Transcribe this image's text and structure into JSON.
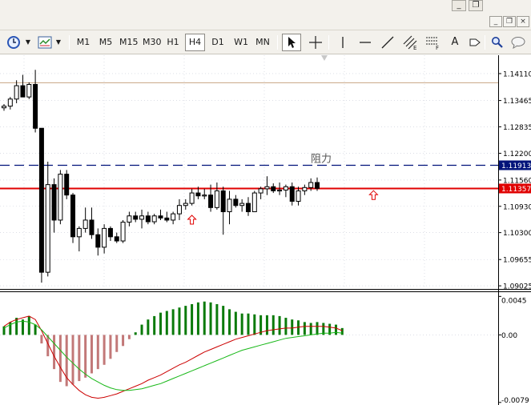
{
  "indicator_colors": {
    "background": "#ffffff",
    "grid": "#c8cbd8",
    "axis": "#000000",
    "resistance_line": "#00137a",
    "price_line": "#e00000",
    "high_line": "#c8a582",
    "histogram_up": "#0a7a0a",
    "histogram_down": "#c27878",
    "macd_line": "#cc0000",
    "signal_line": "#18b818",
    "candle": "#000000"
  },
  "menubar": {
    "mdi_buttons": [
      {
        "icon": "minimize-icon",
        "glyph": "_"
      },
      {
        "icon": "restore-icon",
        "glyph": "❐"
      },
      {
        "icon": "close-icon",
        "glyph": "×"
      }
    ]
  },
  "window_buttons": [
    {
      "icon": "minimize-icon",
      "glyph": "_"
    },
    {
      "icon": "restore-icon",
      "glyph": "❐"
    }
  ],
  "toolbar": {
    "timeframes": [
      {
        "label": "M1",
        "active": false
      },
      {
        "label": "M5",
        "active": false
      },
      {
        "label": "M15",
        "active": false
      },
      {
        "label": "M30",
        "active": false
      },
      {
        "label": "H1",
        "active": false
      },
      {
        "label": "H4",
        "active": true
      },
      {
        "label": "D1",
        "active": false
      },
      {
        "label": "W1",
        "active": false
      },
      {
        "label": "MN",
        "active": false
      }
    ],
    "tools": [
      {
        "icon": "clock-icon"
      },
      {
        "icon": "chart-template-icon"
      },
      {
        "icon": "cursor-icon"
      },
      {
        "icon": "crosshair-icon"
      },
      {
        "icon": "vertical-line-icon"
      },
      {
        "icon": "horizontal-line-icon"
      },
      {
        "icon": "trendline-icon"
      },
      {
        "icon": "equidistant-channel-icon",
        "letter": "E"
      },
      {
        "icon": "fibonacci-icon",
        "letter": "F"
      },
      {
        "icon": "text-tool-icon",
        "letter": "A"
      },
      {
        "icon": "text-label-icon"
      },
      {
        "icon": "search-icon"
      },
      {
        "icon": "chat-icon"
      }
    ]
  },
  "chart_data": [
    {
      "type": "candlestick",
      "ylim": [
        1.0895,
        1.1455
      ],
      "y_ticks": [
        "1.14110",
        "1.13465",
        "1.12835",
        "1.12200",
        "1.11560",
        "1.10930",
        "1.10300",
        "1.09655",
        "1.09025"
      ],
      "y_tick_values": [
        1.1411,
        1.13465,
        1.12835,
        1.122,
        1.1156,
        1.1093,
        1.103,
        1.09655,
        1.09025
      ],
      "resistance": {
        "value": 1.11913,
        "label": "1.11913",
        "text": "阻力"
      },
      "current_price": {
        "value": 1.11357,
        "label": "1.11357"
      },
      "high_line": 1.1389,
      "arrow_markers": [
        {
          "candle": 30,
          "price": 1.106
        },
        {
          "candle": 59,
          "price": 1.1119
        }
      ],
      "candles": [
        [
          1.1329,
          1.1338,
          1.1322,
          1.1333
        ],
        [
          1.1333,
          1.1355,
          1.1325,
          1.135
        ],
        [
          1.135,
          1.1395,
          1.134,
          1.1382
        ],
        [
          1.1382,
          1.1408,
          1.136,
          1.1355
        ],
        [
          1.1355,
          1.139,
          1.135,
          1.1385
        ],
        [
          1.1385,
          1.142,
          1.127,
          1.128
        ],
        [
          1.128,
          1.1235,
          1.091,
          1.0935
        ],
        [
          1.0935,
          1.12,
          1.0925,
          1.1145
        ],
        [
          1.1145,
          1.116,
          1.103,
          1.106
        ],
        [
          1.106,
          1.118,
          1.105,
          1.117
        ],
        [
          1.117,
          1.118,
          1.111,
          1.112
        ],
        [
          1.112,
          1.1125,
          1.1005,
          1.102
        ],
        [
          1.102,
          1.1045,
          1.0985,
          1.104
        ],
        [
          1.104,
          1.109,
          1.103,
          1.106
        ],
        [
          1.106,
          1.109,
          1.1015,
          1.1025
        ],
        [
          1.1025,
          1.104,
          1.0975,
          1.0995
        ],
        [
          1.0995,
          1.105,
          1.098,
          1.104
        ],
        [
          1.104,
          1.1045,
          1.101,
          1.102
        ],
        [
          1.102,
          1.103,
          1.1005,
          1.101
        ],
        [
          1.101,
          1.106,
          1.1005,
          1.1055
        ],
        [
          1.1055,
          1.108,
          1.1045,
          1.107
        ],
        [
          1.107,
          1.108,
          1.1055,
          1.1062
        ],
        [
          1.1062,
          1.1085,
          1.104,
          1.107
        ],
        [
          1.107,
          1.108,
          1.105,
          1.1056
        ],
        [
          1.1056,
          1.1075,
          1.105,
          1.107
        ],
        [
          1.107,
          1.1085,
          1.106,
          1.1065
        ],
        [
          1.1065,
          1.108,
          1.1055,
          1.106
        ],
        [
          1.106,
          1.108,
          1.105,
          1.1075
        ],
        [
          1.1075,
          1.111,
          1.106,
          1.1095
        ],
        [
          1.1095,
          1.111,
          1.1085,
          1.11
        ],
        [
          1.11,
          1.1135,
          1.1095,
          1.1125
        ],
        [
          1.1125,
          1.114,
          1.111,
          1.1118
        ],
        [
          1.1118,
          1.1135,
          1.111,
          1.112
        ],
        [
          1.112,
          1.1145,
          1.108,
          1.109
        ],
        [
          1.109,
          1.115,
          1.1085,
          1.113
        ],
        [
          1.113,
          1.114,
          1.1025,
          1.108
        ],
        [
          1.108,
          1.113,
          1.105,
          1.111
        ],
        [
          1.111,
          1.112,
          1.109,
          1.1095
        ],
        [
          1.1095,
          1.111,
          1.108,
          1.11
        ],
        [
          1.11,
          1.1115,
          1.107,
          1.108
        ],
        [
          1.108,
          1.113,
          1.108,
          1.1125
        ],
        [
          1.1125,
          1.114,
          1.111,
          1.1135
        ],
        [
          1.1135,
          1.1165,
          1.112,
          1.114
        ],
        [
          1.114,
          1.1148,
          1.1125,
          1.113
        ],
        [
          1.113,
          1.115,
          1.112,
          1.1132
        ],
        [
          1.1132,
          1.1145,
          1.1115,
          1.114
        ],
        [
          1.114,
          1.115,
          1.1095,
          1.1105
        ],
        [
          1.1105,
          1.114,
          1.1095,
          1.113
        ],
        [
          1.113,
          1.1145,
          1.112,
          1.1138
        ],
        [
          1.1138,
          1.116,
          1.113,
          1.115
        ],
        [
          1.115,
          1.1162,
          1.113,
          1.1136
        ]
      ]
    },
    {
      "type": "bar+line",
      "ylim": [
        -0.0082,
        0.005
      ],
      "y_ticks": [
        "0.0045",
        "0.00",
        "-0.0079"
      ],
      "y_tick_values": [
        0.0045,
        0.0,
        -0.0079
      ],
      "histogram": [
        0.001,
        0.0015,
        0.002,
        0.0018,
        0.0022,
        0.0012,
        -0.001,
        -0.0025,
        -0.004,
        -0.0055,
        -0.006,
        -0.0058,
        -0.0054,
        -0.005,
        -0.0045,
        -0.004,
        -0.0035,
        -0.0028,
        -0.002,
        -0.0013,
        -0.0005,
        0.0003,
        0.0012,
        0.0018,
        0.0022,
        0.0026,
        0.0028,
        0.003,
        0.0032,
        0.0034,
        0.0036,
        0.0038,
        0.0039,
        0.0038,
        0.0036,
        0.0034,
        0.003,
        0.0027,
        0.0025,
        0.0025,
        0.0024,
        0.0023,
        0.0023,
        0.0023,
        0.0022,
        0.002,
        0.0018,
        0.0017,
        0.0015,
        0.0014,
        0.0015,
        0.0014,
        0.0013,
        0.0012,
        0.0008
      ],
      "macd": [
        0.001,
        0.0015,
        0.0018,
        0.002,
        0.0022,
        0.0018,
        0.0005,
        -0.001,
        -0.0025,
        -0.0038,
        -0.005,
        -0.0058,
        -0.0065,
        -0.007,
        -0.0073,
        -0.0074,
        -0.0073,
        -0.0071,
        -0.0069,
        -0.0066,
        -0.0063,
        -0.006,
        -0.0057,
        -0.0053,
        -0.005,
        -0.0047,
        -0.0043,
        -0.0039,
        -0.0035,
        -0.0032,
        -0.0028,
        -0.0024,
        -0.002,
        -0.0017,
        -0.0014,
        -0.0011,
        -0.0008,
        -0.0005,
        -0.0003,
        -0.0001,
        0.0001,
        0.0003,
        0.0005,
        0.0006,
        0.0007,
        0.0008,
        0.0008,
        0.0009,
        0.001,
        0.001,
        0.001,
        0.001,
        0.0009,
        0.0008,
        0.0005
      ],
      "signal": [
        0.0008,
        0.0012,
        0.0015,
        0.0016,
        0.0015,
        0.0012,
        0.0006,
        -0.0002,
        -0.001,
        -0.0018,
        -0.0026,
        -0.0033,
        -0.004,
        -0.0046,
        -0.0051,
        -0.0055,
        -0.0059,
        -0.0062,
        -0.0064,
        -0.0065,
        -0.0065,
        -0.0064,
        -0.0063,
        -0.0061,
        -0.0059,
        -0.0057,
        -0.0054,
        -0.0051,
        -0.0048,
        -0.0045,
        -0.0042,
        -0.0039,
        -0.0036,
        -0.0033,
        -0.003,
        -0.0027,
        -0.0024,
        -0.0021,
        -0.0018,
        -0.0016,
        -0.0014,
        -0.0012,
        -0.001,
        -0.0008,
        -0.0006,
        -0.0004,
        -0.0003,
        -0.0002,
        -0.0001,
        0.0,
        0.0001,
        0.0002,
        0.0002,
        0.0003,
        0.0002
      ]
    }
  ]
}
